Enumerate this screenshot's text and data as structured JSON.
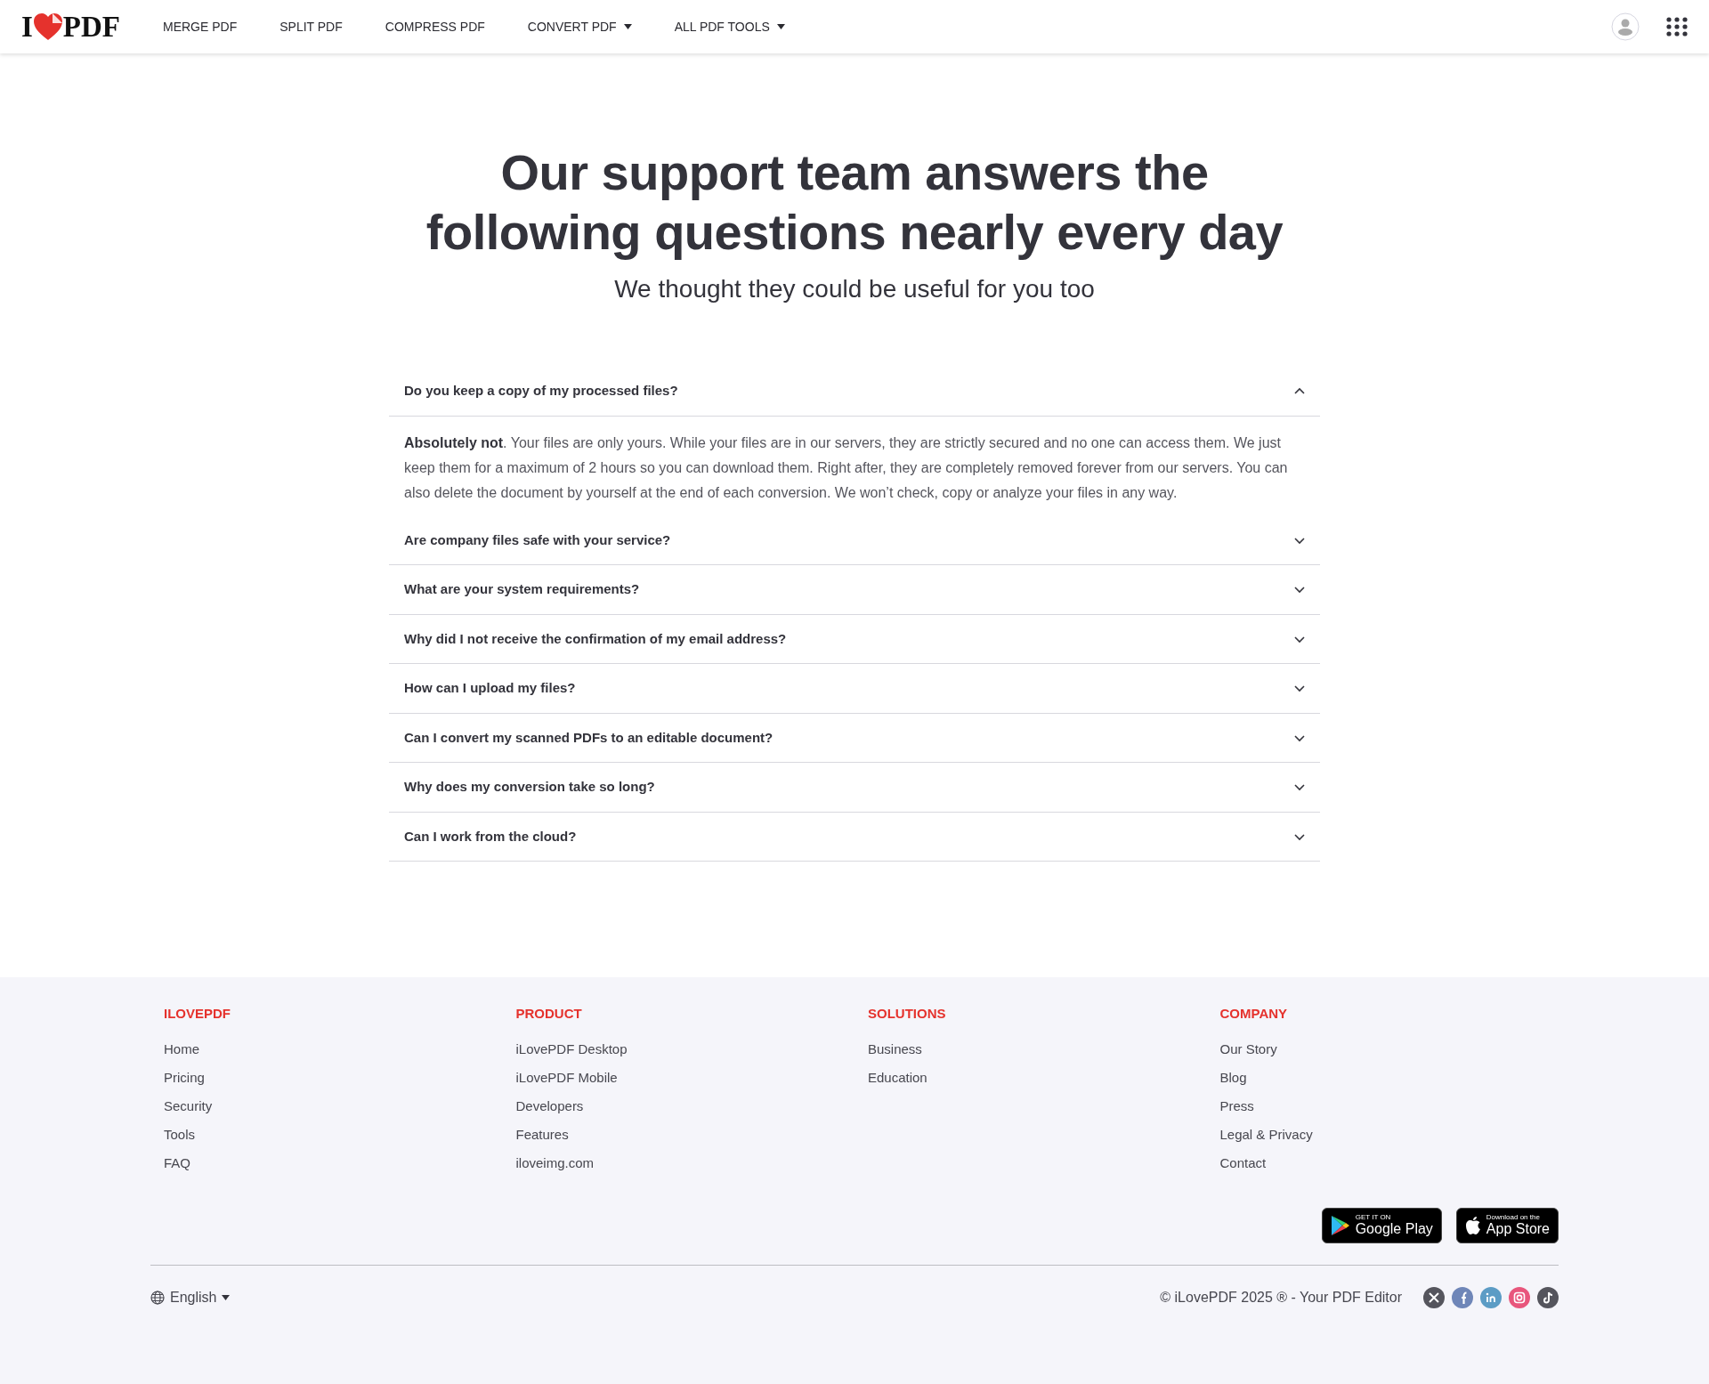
{
  "header": {
    "logo": {
      "left": "I",
      "right": "PDF"
    },
    "nav": [
      {
        "label": "MERGE PDF",
        "dropdown": false
      },
      {
        "label": "SPLIT PDF",
        "dropdown": false
      },
      {
        "label": "COMPRESS PDF",
        "dropdown": false
      },
      {
        "label": "CONVERT PDF",
        "dropdown": true
      },
      {
        "label": "ALL PDF TOOLS",
        "dropdown": true
      }
    ]
  },
  "hero": {
    "title": "Our support team answers the following questions nearly every day",
    "subtitle": "We thought they could be useful for you too"
  },
  "faq": [
    {
      "question": "Do you keep a copy of my processed files?",
      "expanded": true,
      "answer": "**Absolutely not**. Your files are only yours. While your files are in our servers, they are strictly secured and no one can access them. We just keep them for a maximum of 2 hours so you can download them. Right after, they are completely removed forever from our servers. You can also delete the document by yourself at the end of each conversion. We won’t check, copy or analyze your files in any way."
    },
    {
      "question": "Are company files safe with your service?",
      "expanded": false
    },
    {
      "question": "What are your system requirements?",
      "expanded": false
    },
    {
      "question": "Why did I not receive the confirmation of my email address?",
      "expanded": false
    },
    {
      "question": "How can I upload my files?",
      "expanded": false
    },
    {
      "question": "Can I convert my scanned PDFs to an editable document?",
      "expanded": false
    },
    {
      "question": "Why does my conversion take so long?",
      "expanded": false
    },
    {
      "question": "Can I work from the cloud?",
      "expanded": false
    }
  ],
  "footer": {
    "columns": [
      {
        "title": "ILOVEPDF",
        "links": [
          "Home",
          "Pricing",
          "Security",
          "Tools",
          "FAQ"
        ]
      },
      {
        "title": "PRODUCT",
        "links": [
          "iLovePDF Desktop",
          "iLovePDF Mobile",
          "Developers",
          "Features",
          "iloveimg.com"
        ]
      },
      {
        "title": "SOLUTIONS",
        "links": [
          "Business",
          "Education"
        ]
      },
      {
        "title": "COMPANY",
        "links": [
          "Our Story",
          "Blog",
          "Press",
          "Legal & Privacy",
          "Contact"
        ]
      }
    ],
    "stores": [
      {
        "kind": "google",
        "small": "GET IT ON",
        "big": "Google Play"
      },
      {
        "kind": "apple",
        "small": "Download on the",
        "big": "App Store"
      }
    ],
    "language": "English",
    "copyright": "© iLovePDF 2025 ® - Your PDF Editor",
    "social": [
      {
        "kind": "x",
        "color": "#55555d"
      },
      {
        "kind": "facebook",
        "color": "#6f86b8"
      },
      {
        "kind": "linkedin",
        "color": "#5c9cc5"
      },
      {
        "kind": "instagram",
        "color": "#e8567c"
      },
      {
        "kind": "tiktok",
        "color": "#55555d"
      }
    ]
  }
}
